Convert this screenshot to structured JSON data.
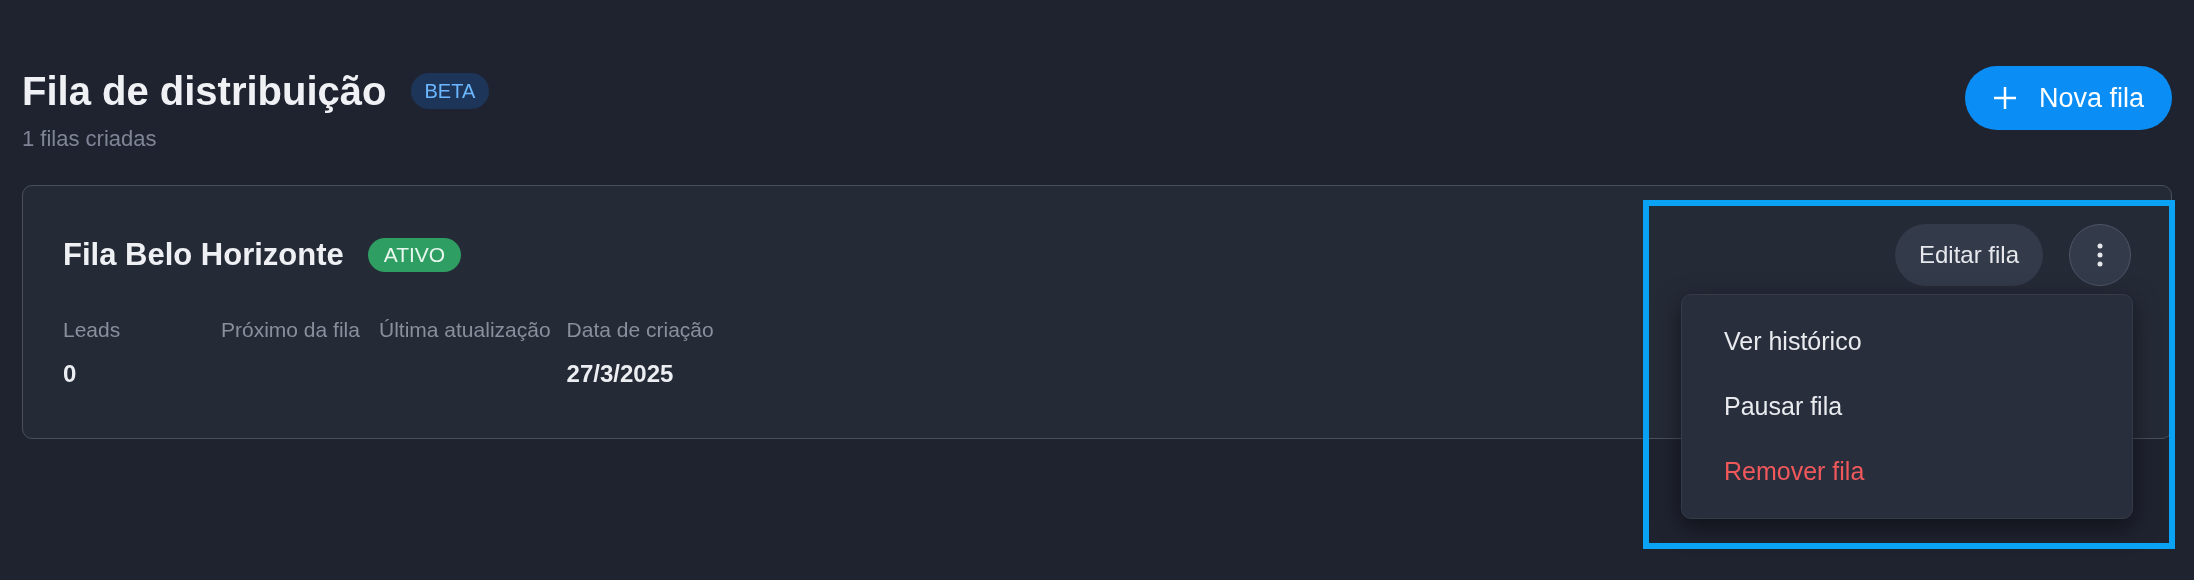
{
  "header": {
    "title": "Fila de distribuição",
    "badge": "BETA",
    "subtitle": "1 filas criadas",
    "new_button": "Nova fila"
  },
  "queues": [
    {
      "name": "Fila Belo Horizonte",
      "status": "ATIVO",
      "active": true,
      "fields": [
        {
          "label": "Leads",
          "value": "0"
        },
        {
          "label": "Próximo da fila"
        },
        {
          "label": "Última atualização"
        },
        {
          "label": "Data de criação",
          "value": "27/3/2025"
        }
      ],
      "edit_button": "Editar fila",
      "menu_open": true,
      "menu": [
        {
          "label": "Ver histórico",
          "kind": "normal"
        },
        {
          "label": "Pausar fila",
          "kind": "normal"
        },
        {
          "label": "Remover fila",
          "kind": "danger"
        }
      ]
    }
  ]
}
